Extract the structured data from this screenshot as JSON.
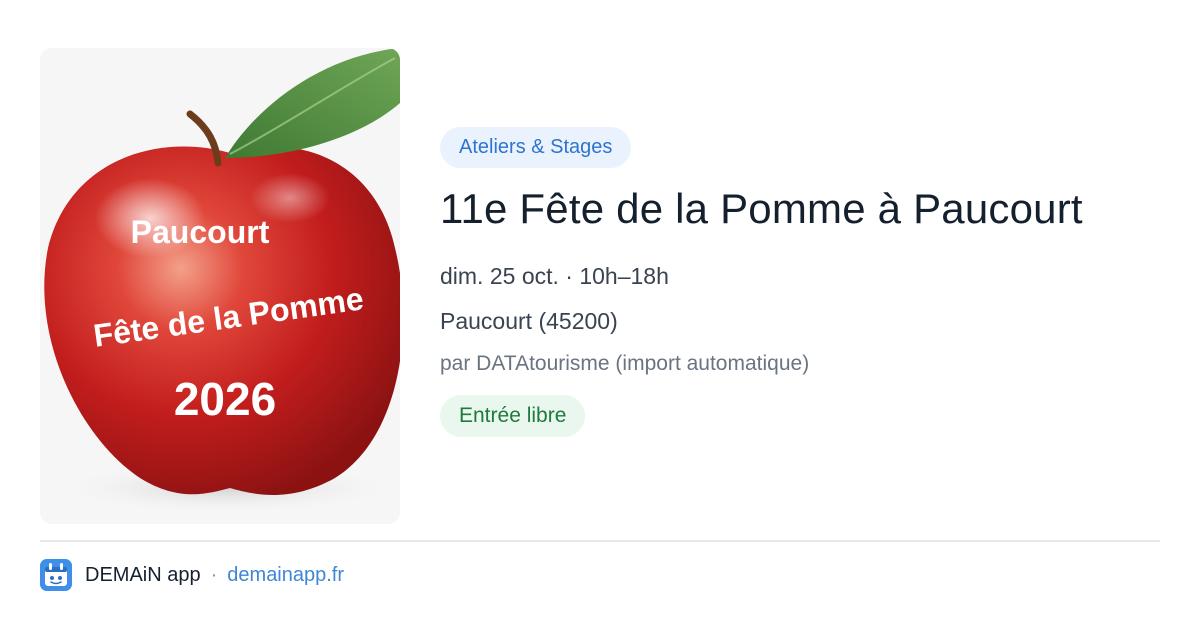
{
  "image": {
    "alt_icon": "apple-poster-image",
    "caption_line1": "Paucourt",
    "caption_line2": "Fête de la Pomme",
    "caption_line3": "2026"
  },
  "event": {
    "category": "Ateliers & Stages",
    "title": "11e Fête de la Pomme à Paucourt",
    "datetime": "dim. 25 oct. · 10h–18h",
    "location": "Paucourt (45200)",
    "source": "par DATAtourisme (import automatique)",
    "price": "Entrée libre"
  },
  "footer": {
    "logo_icon": "demain-app-logo-icon",
    "app_name": "DEMAiN app",
    "separator": "·",
    "domain": "demainapp.fr"
  },
  "colors": {
    "category_bg": "#eaf2fd",
    "category_text": "#2f74d0",
    "price_bg": "#e9f7ee",
    "price_text": "#1f7a3d",
    "link": "#3e87d6",
    "logo_bg": "#3f8fe8"
  }
}
